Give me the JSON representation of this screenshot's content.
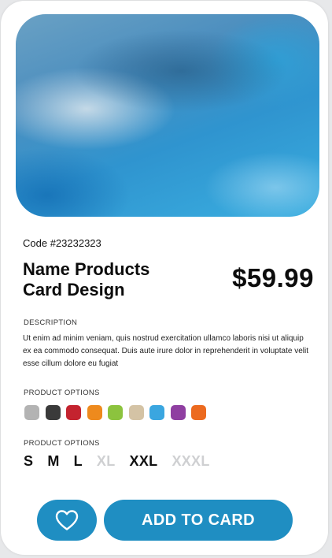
{
  "product": {
    "code": "Code #23232323",
    "title_line1": "Name Products",
    "title_line2": "Card Design",
    "price": "$59.99",
    "image_icon": "product-photo-blurred-blue"
  },
  "description": {
    "label": "DESCRIPTION",
    "text": "Ut enim ad minim veniam, quis nostrud exercitation ullamco laboris nisi ut aliquip ex ea commodo consequat. Duis aute irure dolor in reprehenderit in voluptate velit esse cillum dolore eu fugiat"
  },
  "colors": {
    "label": "PRODUCT OPTIONS",
    "options": [
      "#b3b3b3",
      "#3a3a3a",
      "#c4232f",
      "#ee8a1d",
      "#8cc33e",
      "#d4c3a5",
      "#3aa6e0",
      "#8f3fa1",
      "#ec6a1f"
    ]
  },
  "sizes": {
    "label": "PRODUCT OPTIONS",
    "options": [
      {
        "label": "S",
        "available": true
      },
      {
        "label": "M",
        "available": true
      },
      {
        "label": "L",
        "available": true
      },
      {
        "label": "XL",
        "available": false
      },
      {
        "label": "XXL",
        "available": true
      },
      {
        "label": "XXXL",
        "available": false
      }
    ]
  },
  "actions": {
    "favorite_icon": "heart-icon",
    "add_to_cart_label": "ADD TO CARD"
  },
  "theme": {
    "accent": "#1f8ec2",
    "disabled_text": "#cfd0d2"
  }
}
